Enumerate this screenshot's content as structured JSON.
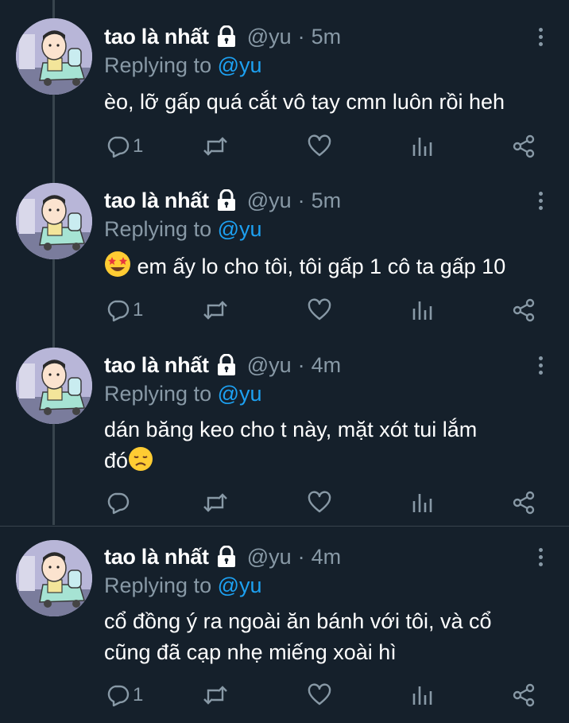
{
  "account": {
    "name": "tao là nhất",
    "handle": "@yu"
  },
  "reply_prefix": "Replying to",
  "reply_mention": "@yu",
  "separator": "·",
  "colors": {
    "background": "#15202b",
    "secondary_text": "#8899a6",
    "accent": "#1da1f2",
    "divider": "#38444d"
  },
  "tweets": [
    {
      "time": "5m",
      "text": "èo, lỡ gấp quá cắt vô tay cmn luôn rồi heh",
      "reply_count": "1"
    },
    {
      "time": "5m",
      "emoji_prefix": "star-struck-emoji",
      "text": "em ấy lo cho tôi, tôi gấp 1 cô ta gấp 10",
      "reply_count": "1"
    },
    {
      "time": "4m",
      "text_line1": "dán băng keo cho t này, mặt xót tui lắm",
      "text_line2": "đó",
      "emoji_suffix": "disappointed-face-emoji",
      "reply_count": ""
    },
    {
      "time": "4m",
      "text_line1": "cổ đồng ý ra ngoài ăn bánh với tôi, và cổ",
      "text_line2": "cũng đã cạp nhẹ miếng xoài hì",
      "reply_count": "1"
    }
  ],
  "icons": [
    "lock-icon",
    "more-icon",
    "reply-icon",
    "retweet-icon",
    "like-icon",
    "analytics-icon",
    "share-icon"
  ]
}
